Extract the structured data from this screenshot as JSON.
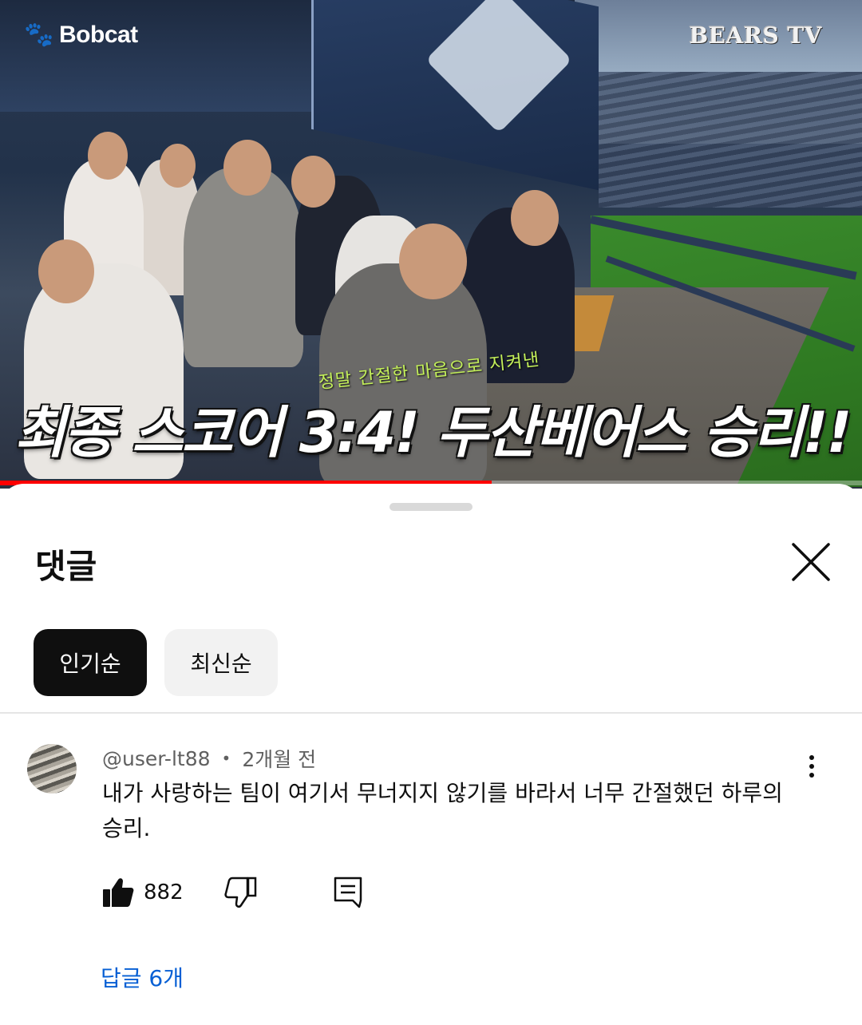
{
  "video": {
    "brand_logo": "Bobcat",
    "channel_logo": "BEARS TV",
    "caption_small": "정말 간절한 마음으로 지켜낸",
    "caption_main": "최종 스코어 3:4! 두산베어스 승리!!",
    "progress_fraction": 0.57
  },
  "sheet": {
    "title": "댓글",
    "sort_chips": [
      {
        "label": "인기순",
        "selected": true
      },
      {
        "label": "최신순",
        "selected": false
      }
    ]
  },
  "comment": {
    "author": "@user-lt88",
    "separator": "•",
    "time": "2개월 전",
    "text": "내가 사랑하는 팀이 여기서 무너지지 않기를 바라서 너무 간절했던 하루의 승리.",
    "likes": "882",
    "replies_label": "답글 6개"
  },
  "icons": {
    "close": "close-icon",
    "more": "more-vertical-icon",
    "like": "thumbs-up-icon",
    "dislike": "thumbs-down-icon",
    "reply": "reply-comment-icon"
  },
  "colors": {
    "progress": "#ff0000",
    "link": "#065fd4",
    "chip_active_bg": "#0f0f0f",
    "chip_inactive_bg": "#f2f2f2"
  }
}
